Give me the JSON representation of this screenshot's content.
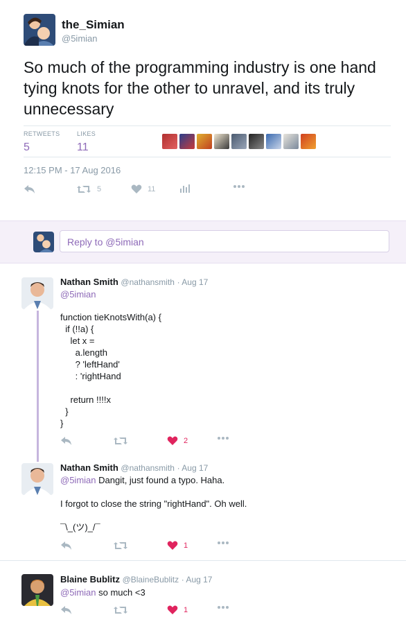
{
  "main_tweet": {
    "author_name": "the_Simian",
    "author_handle": "@5imian",
    "text": "So much of the programming industry is one hand tying knots for the other to unravel, and its truly unnecessary",
    "retweets_label": "RETWEETS",
    "retweets_count": "5",
    "likes_label": "LIKES",
    "likes_count": "11",
    "timestamp": "12:15 PM - 17 Aug 2016",
    "actions": {
      "retweet_count": "5",
      "like_count": "11"
    }
  },
  "reply_box": {
    "placeholder": "Reply to @5imian"
  },
  "replies": [
    {
      "author_name": "Nathan Smith",
      "author_handle": "@nathansmith",
      "date": "· Aug 17",
      "mention": "@5imian",
      "text_after_mention": "",
      "body": "function tieKnotsWith(a) {\n  if (!!a) {\n    let x =\n      a.length\n      ? 'leftHand'\n      : 'rightHand\n\n    return !!!!x\n  }\n}",
      "like_count": "2"
    },
    {
      "author_name": "Nathan Smith",
      "author_handle": "@nathansmith",
      "date": "· Aug 17",
      "mention": "@5imian",
      "text_after_mention": " Dangit, just found a typo. Haha.",
      "body": "I forgot to close the string \"rightHand\". Oh well.\n\n¯\\_(ツ)_/¯",
      "like_count": "1"
    },
    {
      "author_name": "Blaine Bublitz",
      "author_handle": "@BlaineBublitz",
      "date": "· Aug 17",
      "mention": "@5imian",
      "text_after_mention": " so much <3",
      "body": "",
      "like_count": "1"
    }
  ],
  "icons": [
    "reply-icon",
    "retweet-icon",
    "heart-icon",
    "analytics-icon",
    "more-icon"
  ],
  "colors": {
    "accent": "#8e6ab8",
    "like_red": "#e0245e",
    "muted": "#8899a6"
  }
}
